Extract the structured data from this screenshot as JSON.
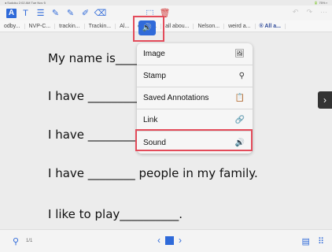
{
  "status_bar": {
    "left": "◂ Sudoku  2:02 AM  Tue Nov 5",
    "right": "🔋 75% ▪"
  },
  "toolbar": {
    "text_tool": "T",
    "comment_tool": "☰",
    "pen_tool_1": "✎",
    "pen_tool_2": "✎",
    "highlighter_tool": "✐",
    "eraser_tool": "⌫",
    "sound_tool": "🔊",
    "select_tool": "⬚",
    "trash_tool": "🗑",
    "undo": "↶",
    "redo": "↷",
    "more": "⋯"
  },
  "tabs": [
    {
      "label": "odby..."
    },
    {
      "label": "NVP-C..."
    },
    {
      "label": "trackin..."
    },
    {
      "label": "Trackin..."
    },
    {
      "label": "Al..."
    },
    {
      "label": "etter+..."
    },
    {
      "label": "all abou..."
    },
    {
      "label": "Nelson..."
    },
    {
      "label": "weird a..."
    },
    {
      "label": "® All a..."
    }
  ],
  "document": {
    "line1": "My name is_________.",
    "line2": "I have _____________",
    "line3": "I have _____________",
    "line4": "I have ________ people in my family.",
    "line5": "I like to play__________."
  },
  "popover": {
    "items": [
      {
        "label": "Image",
        "icon": "🖼"
      },
      {
        "label": "Stamp",
        "icon": "⚲"
      },
      {
        "label": "Saved Annotations",
        "icon": "📋"
      },
      {
        "label": "Link",
        "icon": "🔗"
      },
      {
        "label": "Sound",
        "icon": "🔊"
      }
    ]
  },
  "bottom_bar": {
    "page_indicator": "1/1",
    "search_icon": "⚲",
    "prev": "‹",
    "next": "›",
    "doc_icon": "▤",
    "grid_icon": "⠿"
  },
  "colors": {
    "accent": "#2f6ad9",
    "highlight_border": "#e34b5a"
  }
}
